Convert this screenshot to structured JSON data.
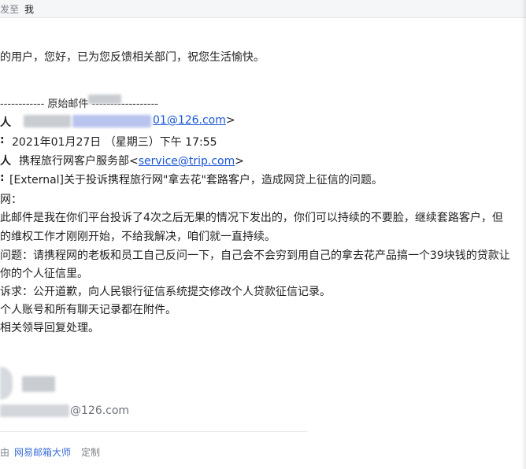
{
  "header": {
    "sent_to_label": "发至",
    "recipient": "我"
  },
  "reply": {
    "text": "的用户，您好，已为您反馈相关部门，祝您生活愉快。"
  },
  "original": {
    "divider_text": "------------ 原始邮件 ------------------",
    "from_label": "人",
    "from_email_visible": "01@126.com",
    "from_suffix": ">",
    "date_label": ":",
    "date_value": "2021年01月27日 （星期三）下午 17:55",
    "to_label": "人",
    "to_name": "携程旅行网客户服务部<",
    "to_email": "service@trip.com",
    "to_suffix": ">",
    "subject_label": ":",
    "subject_value": "[External]关于投诉携程旅行网\"拿去花\"套路客户，造成网贷上征信的问题。"
  },
  "body": {
    "lines": [
      "网：",
      "此邮件是我在你们平台投诉了4次之后无果的情况下发出的，你们可以持续的不要脸，继续套路客户，但",
      "的维权工作才刚刚开始，不给我解决，咱们就一直持续。",
      "问题：请携程网的老板和员工自己反问一下，自己会不会穷到用自己的拿去花产品搞一个39块钱的贷款让",
      "你的个人征信里。",
      "诉求：公开道歉，向人民银行征信系统提交修改个人贷款征信记录。",
      "个人账号和所有聊天记录都在附件。",
      "相关领导回复处理。"
    ]
  },
  "signature": {
    "email_visible": "@126.com"
  },
  "footer": {
    "by_label": "由",
    "app_name": "网易邮箱大师",
    "customize": "定制"
  }
}
